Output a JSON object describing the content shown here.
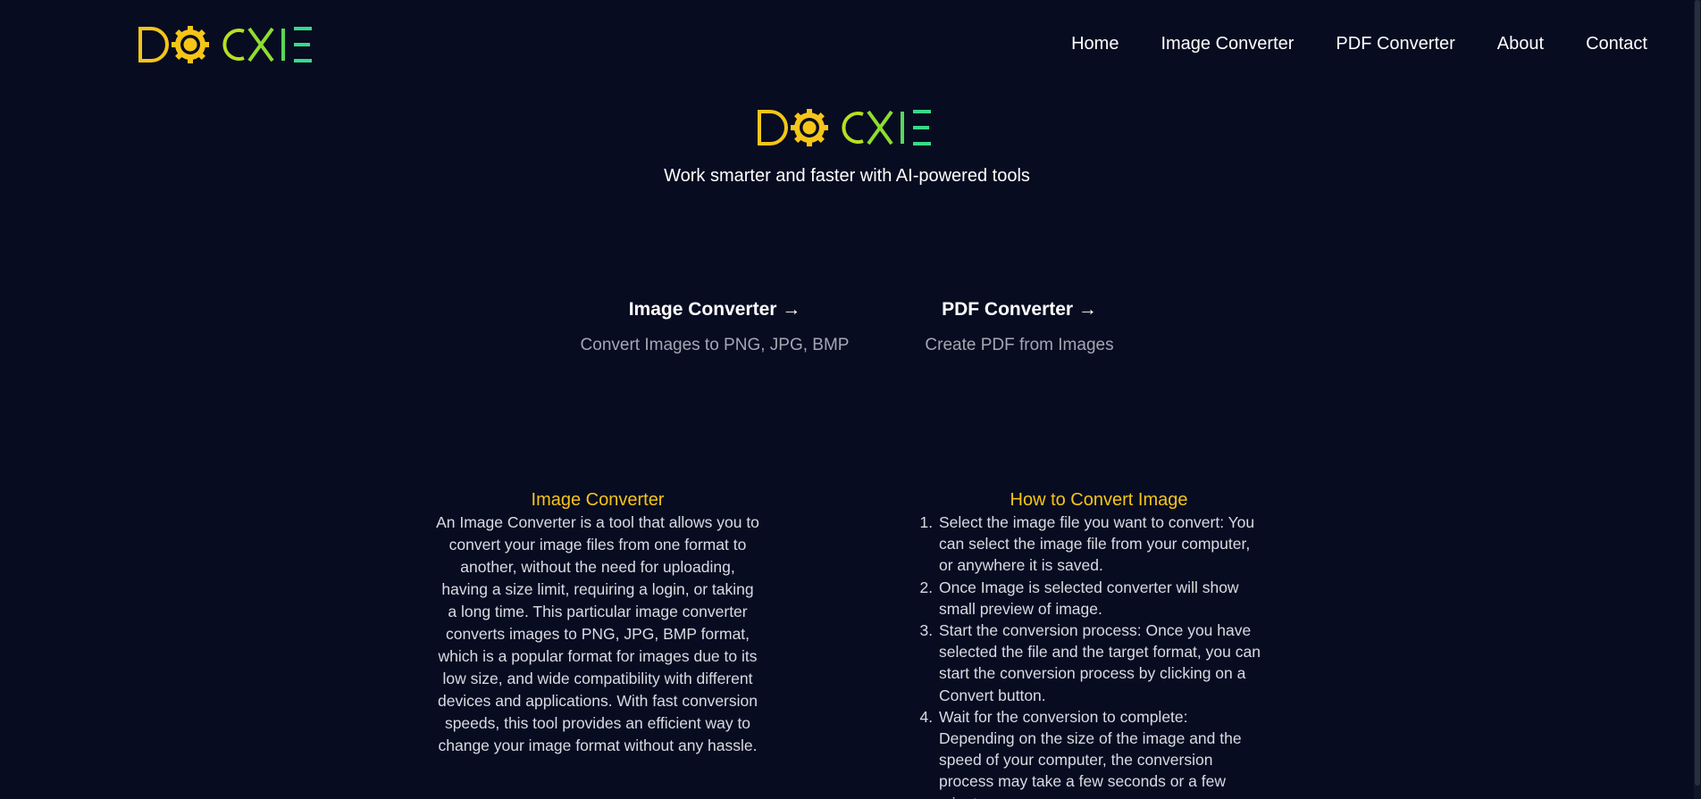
{
  "brand": {
    "name": "DOCXIE",
    "colors": {
      "yellow": "#f5c518",
      "lime": "#b6e021",
      "green": "#39d98a",
      "background": "#070c21"
    }
  },
  "nav": {
    "items": [
      {
        "label": "Home"
      },
      {
        "label": "Image Converter"
      },
      {
        "label": "PDF Converter"
      },
      {
        "label": "About"
      },
      {
        "label": "Contact"
      }
    ]
  },
  "hero": {
    "tagline": "Work smarter and faster with AI-powered tools"
  },
  "tools": [
    {
      "title": "Image Converter →",
      "description": "Convert Images to PNG, JPG, BMP"
    },
    {
      "title": "PDF Converter →",
      "description": "Create PDF from Images"
    }
  ],
  "about": {
    "heading": "Image Converter",
    "body": "An Image Converter is a tool that allows you to convert your image files from one format to another, without the need for uploading, having a size limit, requiring a login, or taking a long time. This particular image converter converts images to PNG, JPG, BMP format, which is a popular format for images due to its low size, and wide compatibility with different devices and applications. With fast conversion speeds, this tool provides an efficient way to change your image format without any hassle."
  },
  "howto": {
    "heading": "How to Convert Image",
    "steps": [
      "Select the image file you want to convert: You can select the image file from your computer, or anywhere it is saved.",
      "Once Image is selected converter will show small preview of image.",
      "Start the conversion process: Once you have selected the file and the target format, you can start the conversion process by clicking on a Convert button.",
      "Wait for the conversion to complete: Depending on the size of the image and the speed of your computer, the conversion process may take a few seconds or a few minutes."
    ]
  }
}
